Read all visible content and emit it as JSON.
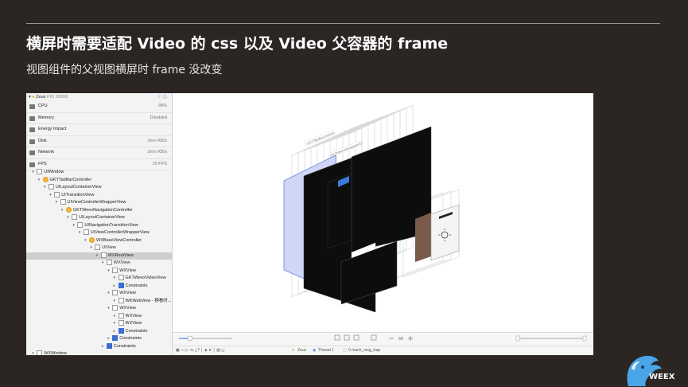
{
  "slide": {
    "title": "横屏时需要适配 Video 的 css 以及 Video 父容器的 frame",
    "subtitle": "视图组件的父视图横屏时 frame 没改变",
    "brand": "WEEX"
  },
  "debugger": {
    "process": {
      "name": "Zeus",
      "pid": "PID 26808"
    },
    "gauges": [
      {
        "name": "CPU",
        "value": "99%"
      },
      {
        "name": "Memory",
        "value": "Disabled"
      },
      {
        "name": "Energy Impact",
        "value": ""
      },
      {
        "name": "Disk",
        "value": "Zero KB/s"
      },
      {
        "name": "Network",
        "value": "Zero KB/s"
      },
      {
        "name": "FPS",
        "value": "29 FPS"
      }
    ],
    "tree": [
      {
        "label": "UIWindow",
        "kind": "view"
      },
      {
        "label": "GKTTabBarController",
        "kind": "vc"
      },
      {
        "label": "UILayoutContainerView",
        "kind": "view"
      },
      {
        "label": "UITransitionView",
        "kind": "view"
      },
      {
        "label": "UIViewControllerWrapperView",
        "kind": "view"
      },
      {
        "label": "GKTWeexNavigationController",
        "kind": "vc"
      },
      {
        "label": "UILayoutContainerView",
        "kind": "view"
      },
      {
        "label": "UINavigationTransitionView",
        "kind": "view"
      },
      {
        "label": "UIViewControllerWrapperView",
        "kind": "view"
      },
      {
        "label": "WXBaseViewController",
        "kind": "vc"
      },
      {
        "label": "UIView",
        "kind": "view"
      },
      {
        "label": "WXRootView",
        "kind": "view"
      },
      {
        "label": "WXView",
        "kind": "view"
      },
      {
        "label": "WXView",
        "kind": "view"
      },
      {
        "label": "GKTWeexVideoView",
        "kind": "view"
      },
      {
        "label": "Constraints",
        "kind": "con"
      },
      {
        "label": "WXView",
        "kind": "view"
      },
      {
        "label": "WKWebView - 榜看时...",
        "kind": "view"
      },
      {
        "label": "WXView",
        "kind": "view"
      },
      {
        "label": "WXView",
        "kind": "view"
      },
      {
        "label": "WXView",
        "kind": "view"
      },
      {
        "label": "Constraints",
        "kind": "con"
      },
      {
        "label": "Constraints",
        "kind": "con"
      },
      {
        "label": "Constraints",
        "kind": "con"
      },
      {
        "label": "WXWindow",
        "kind": "view"
      }
    ],
    "status": {
      "app": "Zeus",
      "thread": "Thread 1",
      "frame": "0 mach_msg_trap"
    },
    "layer_labels": [
      "GKTTabBarControl...",
      "GKTWeexNavigationC..."
    ]
  }
}
